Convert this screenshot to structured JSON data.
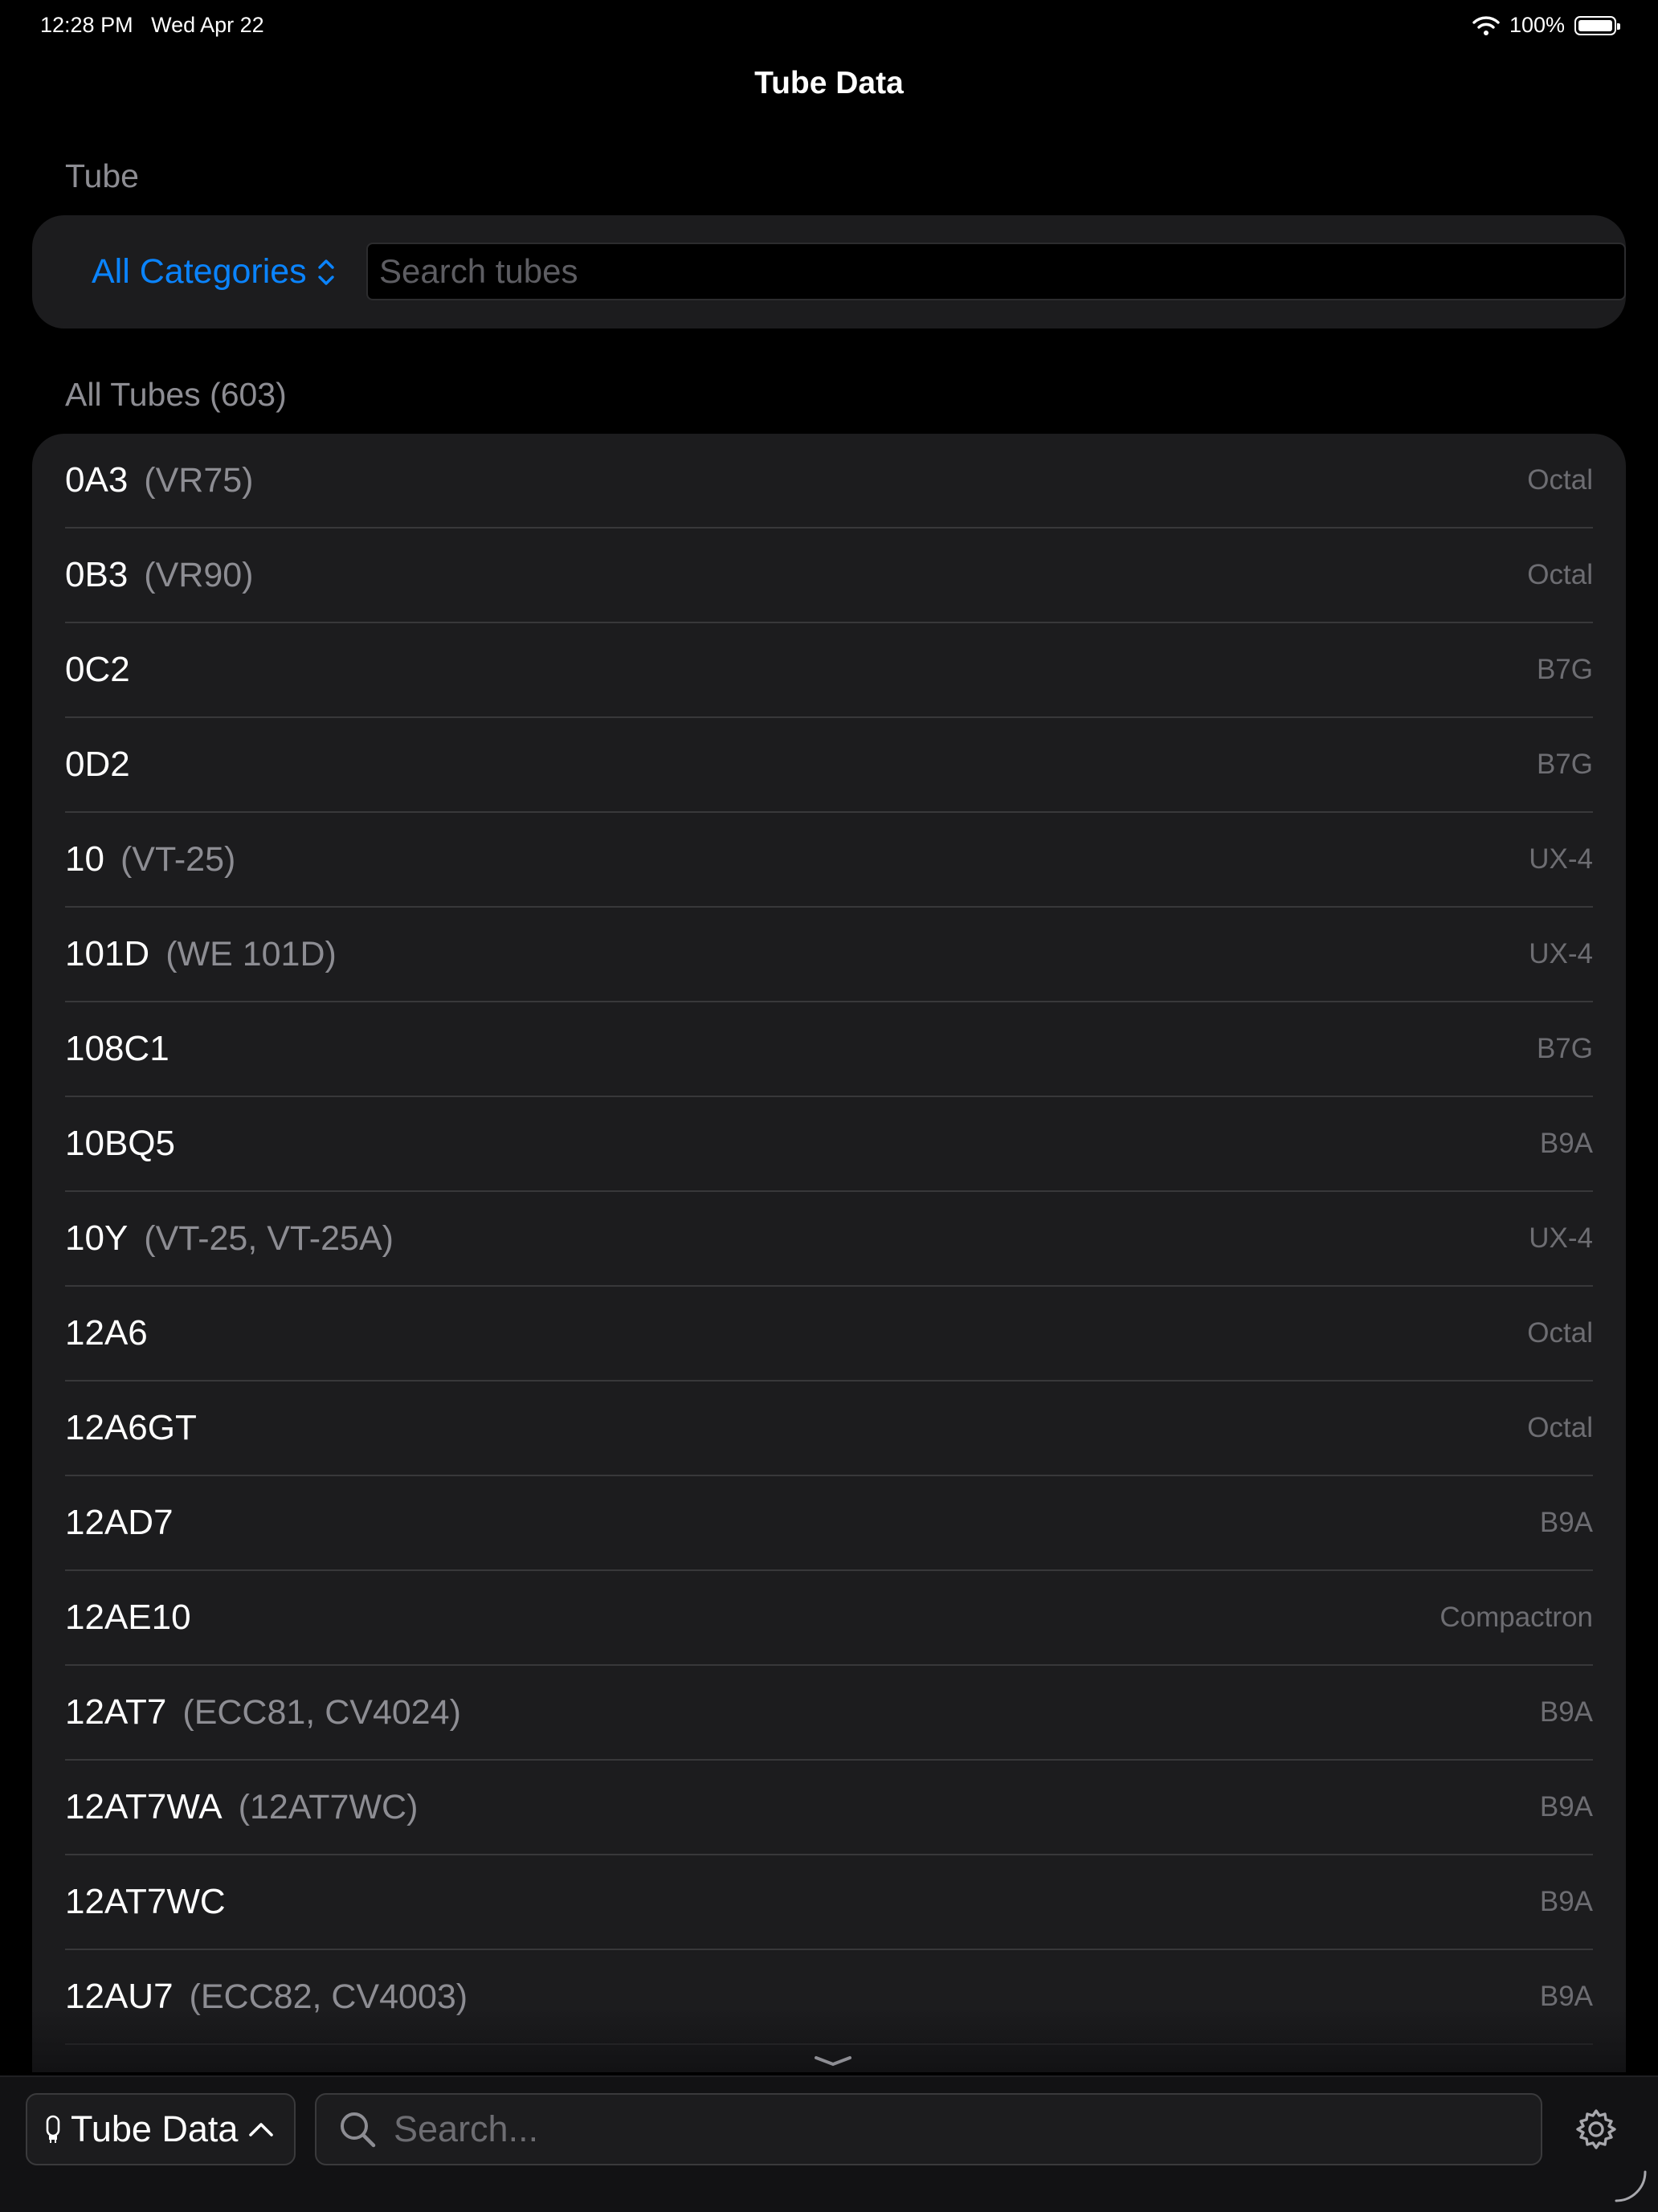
{
  "status_bar": {
    "time": "12:28 PM",
    "date": "Wed Apr 22",
    "battery": "100%"
  },
  "nav": {
    "title": "Tube Data"
  },
  "filter": {
    "section_label": "Tube",
    "category": "All Categories",
    "search_placeholder": "Search tubes"
  },
  "list": {
    "section_label": "All Tubes (603)",
    "rows": [
      {
        "name": "0A3",
        "alias": "(VR75)",
        "base": "Octal"
      },
      {
        "name": "0B3",
        "alias": "(VR90)",
        "base": "Octal"
      },
      {
        "name": "0C2",
        "alias": "",
        "base": "B7G"
      },
      {
        "name": "0D2",
        "alias": "",
        "base": "B7G"
      },
      {
        "name": "10",
        "alias": "(VT-25)",
        "base": "UX-4"
      },
      {
        "name": "101D",
        "alias": "(WE 101D)",
        "base": "UX-4"
      },
      {
        "name": "108C1",
        "alias": "",
        "base": "B7G"
      },
      {
        "name": "10BQ5",
        "alias": "",
        "base": "B9A"
      },
      {
        "name": "10Y",
        "alias": "(VT-25, VT-25A)",
        "base": "UX-4"
      },
      {
        "name": "12A6",
        "alias": "",
        "base": "Octal"
      },
      {
        "name": "12A6GT",
        "alias": "",
        "base": "Octal"
      },
      {
        "name": "12AD7",
        "alias": "",
        "base": "B9A"
      },
      {
        "name": "12AE10",
        "alias": "",
        "base": "Compactron"
      },
      {
        "name": "12AT7",
        "alias": "(ECC81, CV4024)",
        "base": "B9A"
      },
      {
        "name": "12AT7WA",
        "alias": "(12AT7WC)",
        "base": "B9A"
      },
      {
        "name": "12AT7WC",
        "alias": "",
        "base": "B9A"
      },
      {
        "name": "12AU7",
        "alias": "(ECC82, CV4003)",
        "base": "B9A"
      }
    ]
  },
  "bottom_bar": {
    "app_label": "Tube Data",
    "search_placeholder": "Search...",
    "icons": [
      "tube-icon",
      "chevron-up-icon",
      "search-icon",
      "gear-icon"
    ]
  },
  "colors": {
    "accent": "#0a84ff",
    "background": "#000000",
    "card": "#1c1c1e",
    "secondary_text": "#8d8d93"
  }
}
